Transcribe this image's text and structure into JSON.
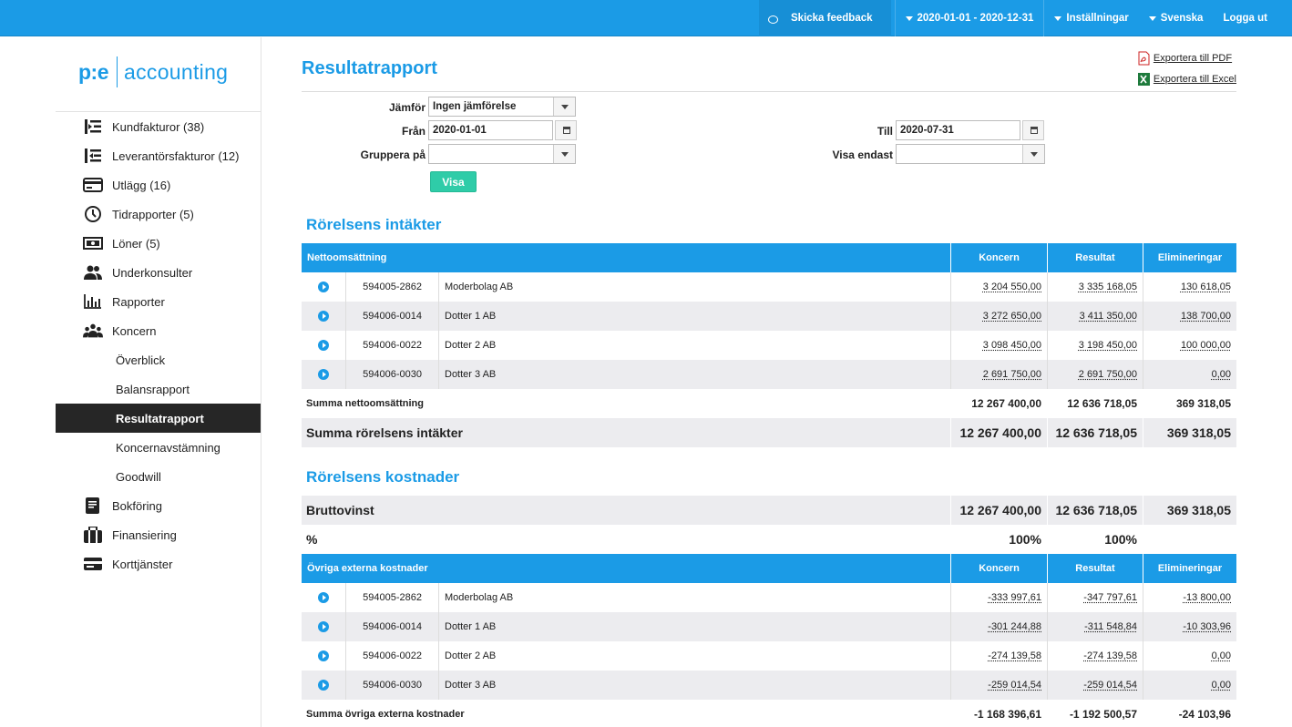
{
  "topbar": {
    "feedback": "Skicka feedback",
    "period": "2020-01-01 - 2020-12-31",
    "settings": "Inställningar",
    "language": "Svenska",
    "logout": "Logga ut"
  },
  "logo": {
    "left": "p:e",
    "right": "accounting"
  },
  "sidebar": {
    "items": [
      {
        "label": "Kundfakturor (38)",
        "icon": "invoice-out-icon"
      },
      {
        "label": "Leverantörsfakturor (12)",
        "icon": "invoice-in-icon"
      },
      {
        "label": "Utlägg (16)",
        "icon": "card-icon"
      },
      {
        "label": "Tidrapporter (5)",
        "icon": "clock-icon"
      },
      {
        "label": "Löner (5)",
        "icon": "money-icon"
      },
      {
        "label": "Underkonsulter",
        "icon": "users-icon"
      },
      {
        "label": "Rapporter",
        "icon": "bar-chart-icon"
      },
      {
        "label": "Koncern",
        "icon": "group-icon"
      }
    ],
    "sub": [
      "Överblick",
      "Balansrapport",
      "Resultatrapport",
      "Koncernavstämning",
      "Goodwill"
    ],
    "items2": [
      {
        "label": "Bokföring",
        "icon": "book-icon"
      },
      {
        "label": "Finansiering",
        "icon": "briefcase-icon"
      },
      {
        "label": "Korttjänster",
        "icon": "credit-card-icon"
      }
    ]
  },
  "page": {
    "title": "Resultatrapport",
    "export_pdf": "Exportera till PDF",
    "export_excel": "Exportera till Excel"
  },
  "form": {
    "compare_label": "Jämför",
    "compare_value": "Ingen jämförelse",
    "from_label": "Från",
    "from_value": "2020-01-01",
    "to_label": "Till",
    "to_value": "2020-07-31",
    "group_label": "Gruppera på",
    "group_value": "",
    "only_label": "Visa endast",
    "only_value": "",
    "show_button": "Visa"
  },
  "income": {
    "section_title": "Rörelsens intäkter",
    "header": {
      "name": "Nettoomsättning",
      "c1": "Koncern",
      "c2": "Resultat",
      "c3": "Elimineringar"
    },
    "rows": [
      {
        "org": "594005-2862",
        "name": "Moderbolag AB",
        "v1": "3 204 550,00",
        "v2": "3 335 168,05",
        "v3": "130 618,05"
      },
      {
        "org": "594006-0014",
        "name": "Dotter 1 AB",
        "v1": "3 272 650,00",
        "v2": "3 411 350,00",
        "v3": "138 700,00"
      },
      {
        "org": "594006-0022",
        "name": "Dotter 2 AB",
        "v1": "3 098 450,00",
        "v2": "3 198 450,00",
        "v3": "100 000,00"
      },
      {
        "org": "594006-0030",
        "name": "Dotter 3 AB",
        "v1": "2 691 750,00",
        "v2": "2 691 750,00",
        "v3": "0,00"
      }
    ],
    "sum": {
      "label": "Summa nettoomsättning",
      "v1": "12 267 400,00",
      "v2": "12 636 718,05",
      "v3": "369 318,05"
    },
    "total": {
      "label": "Summa rörelsens intäkter",
      "v1": "12 267 400,00",
      "v2": "12 636 718,05",
      "v3": "369 318,05"
    }
  },
  "costs": {
    "section_title": "Rörelsens kostnader",
    "gross": {
      "label": "Bruttovinst",
      "v1": "12 267 400,00",
      "v2": "12 636 718,05",
      "v3": "369 318,05"
    },
    "percent": {
      "label": "%",
      "v1": "100%",
      "v2": "100%",
      "v3": ""
    },
    "header": {
      "name": "Övriga externa kostnader",
      "c1": "Koncern",
      "c2": "Resultat",
      "c3": "Elimineringar"
    },
    "rows": [
      {
        "org": "594005-2862",
        "name": "Moderbolag AB",
        "v1": "-333 997,61",
        "v2": "-347 797,61",
        "v3": "-13 800,00"
      },
      {
        "org": "594006-0014",
        "name": "Dotter 1 AB",
        "v1": "-301 244,88",
        "v2": "-311 548,84",
        "v3": "-10 303,96"
      },
      {
        "org": "594006-0022",
        "name": "Dotter 2 AB",
        "v1": "-274 139,58",
        "v2": "-274 139,58",
        "v3": "0,00"
      },
      {
        "org": "594006-0030",
        "name": "Dotter 3 AB",
        "v1": "-259 014,54",
        "v2": "-259 014,54",
        "v3": "0,00"
      }
    ],
    "sum": {
      "label": "Summa övriga externa kostnader",
      "v1": "-1 168 396,61",
      "v2": "-1 192 500,57",
      "v3": "-24 103,96"
    }
  }
}
